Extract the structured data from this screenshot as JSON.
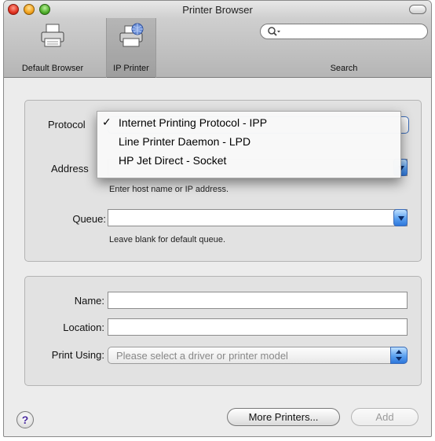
{
  "window": {
    "title": "Printer Browser"
  },
  "toolbar": {
    "default_browser_label": "Default Browser",
    "ip_printer_label": "IP Printer",
    "search_label": "Search"
  },
  "form": {
    "protocol_label": "Protocol",
    "address_label": "Address",
    "address_hint": "Enter host name or IP address.",
    "queue_label": "Queue:",
    "queue_value": "",
    "queue_hint": "Leave blank for default queue.",
    "name_label": "Name:",
    "name_value": "",
    "location_label": "Location:",
    "location_value": "",
    "print_using_label": "Print Using:",
    "print_using_placeholder": "Please select a driver or printer model"
  },
  "protocol_menu": {
    "items": [
      {
        "label": "Internet Printing Protocol - IPP",
        "checked": "✓"
      },
      {
        "label": "Line Printer Daemon - LPD",
        "checked": ""
      },
      {
        "label": "HP Jet Direct - Socket",
        "checked": ""
      }
    ]
  },
  "buttons": {
    "help": "?",
    "more_printers": "More Printers...",
    "add": "Add"
  },
  "colors": {
    "accent": "#3a6bb8",
    "window_bg": "#ececec",
    "disabled_text": "#9a9a9a"
  }
}
